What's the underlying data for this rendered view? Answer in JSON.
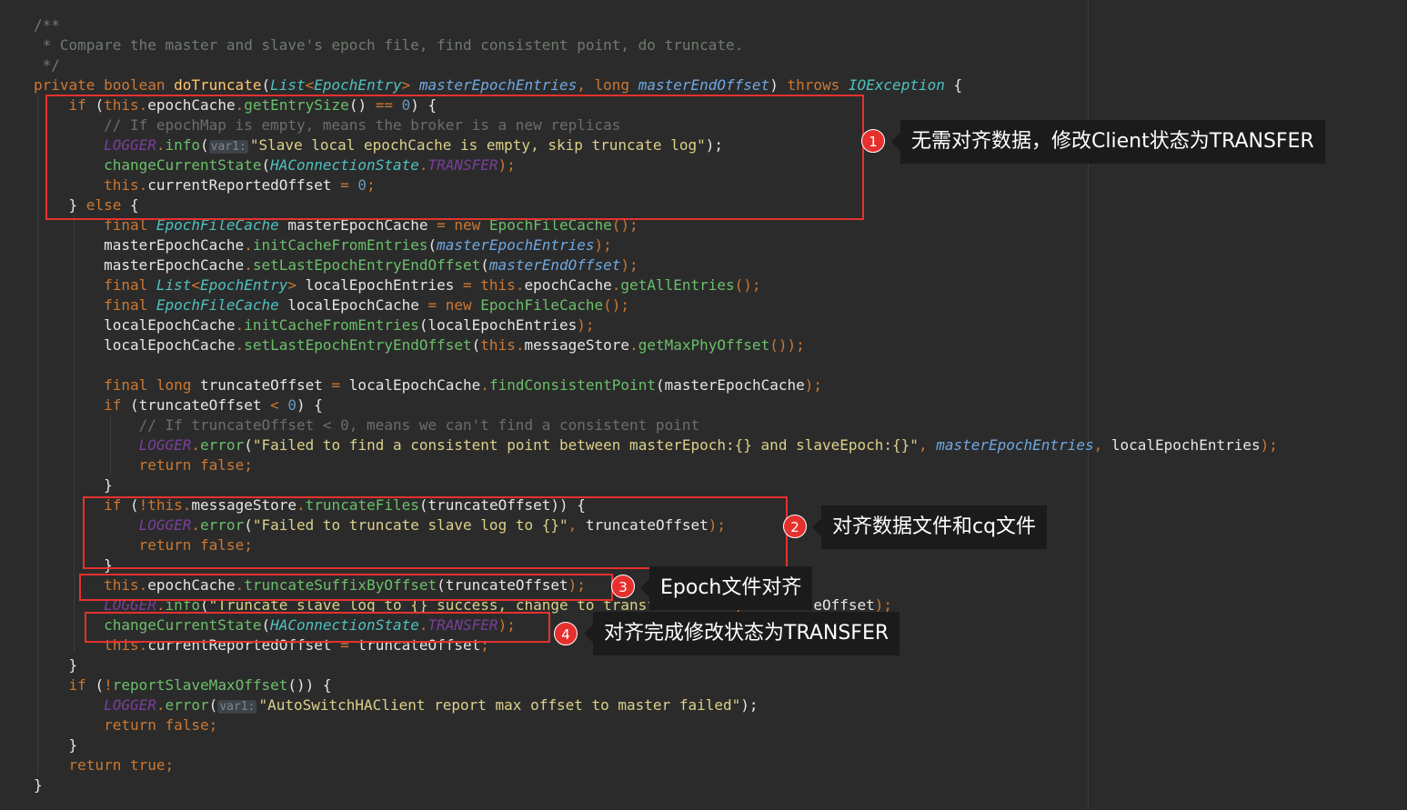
{
  "code_lines": [
    [
      [
        "/**",
        "t-doc"
      ]
    ],
    [
      [
        " * Compare the master and slave's epoch file, find consistent point, do truncate.",
        "t-doc"
      ]
    ],
    [
      [
        " */",
        "t-doc"
      ]
    ],
    [
      [
        "private ",
        "t-kw"
      ],
      [
        "boolean ",
        "t-kw"
      ],
      [
        "doTruncate",
        "t-fn"
      ],
      [
        "(",
        "t-plain"
      ],
      [
        "List",
        "t-cls2"
      ],
      [
        "<",
        "t-kw"
      ],
      [
        "EpochEntry",
        "t-cls2"
      ],
      [
        "> ",
        "t-kw"
      ],
      [
        "masterEpochEntries",
        "t-param"
      ],
      [
        ", ",
        "t-kw"
      ],
      [
        "long ",
        "t-kw"
      ],
      [
        "masterEndOffset",
        "t-param"
      ],
      [
        ") ",
        "t-plain"
      ],
      [
        "throws ",
        "t-kw"
      ],
      [
        "IOException ",
        "t-cls2"
      ],
      [
        "{",
        "t-plain"
      ]
    ],
    [
      [
        "    "
      ],
      [
        "if ",
        "t-kw"
      ],
      [
        "(",
        "t-plain"
      ],
      [
        "this",
        "t-kw"
      ],
      [
        ".",
        "t-kw"
      ],
      [
        "epochCache",
        "t-plain"
      ],
      [
        ".",
        "t-kw"
      ],
      [
        "getEntrySize",
        "t-method"
      ],
      [
        "() ",
        "t-plain"
      ],
      [
        "== ",
        "t-kw"
      ],
      [
        "0",
        "t-num"
      ],
      [
        ") {",
        "t-plain"
      ]
    ],
    [
      [
        "        "
      ],
      [
        "// If epochMap is empty, means the broker is a new replicas",
        "t-cmt"
      ]
    ],
    [
      [
        "        "
      ],
      [
        "LOGGER",
        "t-const"
      ],
      [
        ".",
        "t-kw"
      ],
      [
        "info",
        "t-method"
      ],
      [
        "(",
        "t-plain"
      ],
      [
        "var1:",
        "t-hint-x"
      ],
      [
        "\"Slave local epochCache is empty, skip truncate log\"",
        "t-str"
      ],
      [
        ");",
        "t-plain"
      ]
    ],
    [
      [
        "        "
      ],
      [
        "changeCurrentState",
        "t-method"
      ],
      [
        "(",
        "t-plain"
      ],
      [
        "HAConnectionState",
        "t-cls2"
      ],
      [
        ".",
        "t-kw"
      ],
      [
        "TRANSFER",
        "t-const"
      ],
      [
        ");",
        "t-kw"
      ]
    ],
    [
      [
        "        "
      ],
      [
        "this",
        "t-kw"
      ],
      [
        ".",
        "t-kw"
      ],
      [
        "currentReportedOffset ",
        "t-plain"
      ],
      [
        "= ",
        "t-kw"
      ],
      [
        "0",
        "t-num"
      ],
      [
        ";",
        "t-kw"
      ]
    ],
    [
      [
        "    "
      ],
      [
        "} ",
        "t-plain"
      ],
      [
        "else ",
        "t-kw"
      ],
      [
        "{",
        "t-plain"
      ]
    ],
    [
      [
        "        "
      ],
      [
        "final ",
        "t-kw"
      ],
      [
        "EpochFileCache ",
        "t-cls2"
      ],
      [
        "masterEpochCache ",
        "t-plain"
      ],
      [
        "= ",
        "t-kw"
      ],
      [
        "new ",
        "t-kw"
      ],
      [
        "EpochFileCache",
        "t-method"
      ],
      [
        "();",
        "t-kw"
      ]
    ],
    [
      [
        "        "
      ],
      [
        "masterEpochCache",
        "t-plain"
      ],
      [
        ".",
        "t-kw"
      ],
      [
        "initCacheFromEntries",
        "t-method"
      ],
      [
        "(",
        "t-plain"
      ],
      [
        "masterEpochEntries",
        "t-param"
      ],
      [
        ");",
        "t-kw"
      ]
    ],
    [
      [
        "        "
      ],
      [
        "masterEpochCache",
        "t-plain"
      ],
      [
        ".",
        "t-kw"
      ],
      [
        "setLastEpochEntryEndOffset",
        "t-method"
      ],
      [
        "(",
        "t-plain"
      ],
      [
        "masterEndOffset",
        "t-param"
      ],
      [
        ");",
        "t-kw"
      ]
    ],
    [
      [
        "        "
      ],
      [
        "final ",
        "t-kw"
      ],
      [
        "List",
        "t-cls2"
      ],
      [
        "<",
        "t-kw"
      ],
      [
        "EpochEntry",
        "t-cls2"
      ],
      [
        "> ",
        "t-kw"
      ],
      [
        "localEpochEntries ",
        "t-plain"
      ],
      [
        "= ",
        "t-kw"
      ],
      [
        "this",
        "t-kw"
      ],
      [
        ".",
        "t-kw"
      ],
      [
        "epochCache",
        "t-plain"
      ],
      [
        ".",
        "t-kw"
      ],
      [
        "getAllEntries",
        "t-method"
      ],
      [
        "();",
        "t-kw"
      ]
    ],
    [
      [
        "        "
      ],
      [
        "final ",
        "t-kw"
      ],
      [
        "EpochFileCache ",
        "t-cls2"
      ],
      [
        "localEpochCache ",
        "t-plain"
      ],
      [
        "= ",
        "t-kw"
      ],
      [
        "new ",
        "t-kw"
      ],
      [
        "EpochFileCache",
        "t-method"
      ],
      [
        "();",
        "t-kw"
      ]
    ],
    [
      [
        "        "
      ],
      [
        "localEpochCache",
        "t-plain"
      ],
      [
        ".",
        "t-kw"
      ],
      [
        "initCacheFromEntries",
        "t-method"
      ],
      [
        "(",
        "t-plain"
      ],
      [
        "localEpochEntries",
        "t-plain"
      ],
      [
        ");",
        "t-kw"
      ]
    ],
    [
      [
        "        "
      ],
      [
        "localEpochCache",
        "t-plain"
      ],
      [
        ".",
        "t-kw"
      ],
      [
        "setLastEpochEntryEndOffset",
        "t-method"
      ],
      [
        "(",
        "t-plain"
      ],
      [
        "this",
        "t-kw"
      ],
      [
        ".",
        "t-kw"
      ],
      [
        "messageStore",
        "t-plain"
      ],
      [
        ".",
        "t-kw"
      ],
      [
        "getMaxPhyOffset",
        "t-method"
      ],
      [
        "());",
        "t-kw"
      ]
    ],
    [
      [
        ""
      ]
    ],
    [
      [
        "        "
      ],
      [
        "final ",
        "t-kw"
      ],
      [
        "long ",
        "t-kw"
      ],
      [
        "truncateOffset ",
        "t-plain"
      ],
      [
        "= ",
        "t-kw"
      ],
      [
        "localEpochCache",
        "t-plain"
      ],
      [
        ".",
        "t-kw"
      ],
      [
        "findConsistentPoint",
        "t-method"
      ],
      [
        "(",
        "t-plain"
      ],
      [
        "masterEpochCache",
        "t-plain"
      ],
      [
        ");",
        "t-kw"
      ]
    ],
    [
      [
        "        "
      ],
      [
        "if ",
        "t-kw"
      ],
      [
        "(",
        "t-plain"
      ],
      [
        "truncateOffset ",
        "t-plain"
      ],
      [
        "< ",
        "t-kw"
      ],
      [
        "0",
        "t-num"
      ],
      [
        ") {",
        "t-plain"
      ]
    ],
    [
      [
        "            "
      ],
      [
        "// If truncateOffset < 0, means we can't find a consistent point",
        "t-cmt"
      ]
    ],
    [
      [
        "            "
      ],
      [
        "LOGGER",
        "t-const"
      ],
      [
        ".",
        "t-kw"
      ],
      [
        "error",
        "t-method"
      ],
      [
        "(",
        "t-plain"
      ],
      [
        "\"Failed to find a consistent point between masterEpoch:{} and slaveEpoch:{}\"",
        "t-str"
      ],
      [
        ", ",
        "t-kw"
      ],
      [
        "masterEpochEntries",
        "t-param"
      ],
      [
        ", ",
        "t-kw"
      ],
      [
        "localEpochEntries",
        "t-plain"
      ],
      [
        ");",
        "t-kw"
      ]
    ],
    [
      [
        "            "
      ],
      [
        "return ",
        "t-kw"
      ],
      [
        "false",
        "t-kw"
      ],
      [
        ";",
        "t-kw"
      ]
    ],
    [
      [
        "        "
      ],
      [
        "}",
        "t-plain"
      ]
    ],
    [
      [
        "        "
      ],
      [
        "if ",
        "t-kw"
      ],
      [
        "(",
        "t-plain"
      ],
      [
        "!",
        "t-kw"
      ],
      [
        "this",
        "t-kw"
      ],
      [
        ".",
        "t-kw"
      ],
      [
        "messageStore",
        "t-plain"
      ],
      [
        ".",
        "t-kw"
      ],
      [
        "truncateFiles",
        "t-method"
      ],
      [
        "(",
        "t-plain"
      ],
      [
        "truncateOffset",
        "t-plain"
      ],
      [
        ")) {",
        "t-plain"
      ]
    ],
    [
      [
        "            "
      ],
      [
        "LOGGER",
        "t-const"
      ],
      [
        ".",
        "t-kw"
      ],
      [
        "error",
        "t-method"
      ],
      [
        "(",
        "t-plain"
      ],
      [
        "\"Failed to truncate slave log to {}\"",
        "t-str"
      ],
      [
        ", ",
        "t-kw"
      ],
      [
        "truncateOffset",
        "t-plain"
      ],
      [
        ");",
        "t-kw"
      ]
    ],
    [
      [
        "            "
      ],
      [
        "return ",
        "t-kw"
      ],
      [
        "false",
        "t-kw"
      ],
      [
        ";",
        "t-kw"
      ]
    ],
    [
      [
        "        "
      ],
      [
        "}",
        "t-plain"
      ]
    ],
    [
      [
        "        "
      ],
      [
        "this",
        "t-kw"
      ],
      [
        ".",
        "t-kw"
      ],
      [
        "epochCache",
        "t-plain"
      ],
      [
        ".",
        "t-kw"
      ],
      [
        "truncateSuffixByOffset",
        "t-method"
      ],
      [
        "(",
        "t-plain"
      ],
      [
        "truncateOffset",
        "t-plain"
      ],
      [
        ");",
        "t-kw"
      ]
    ],
    [
      [
        "        "
      ],
      [
        "LOGGER",
        "t-const"
      ],
      [
        ".",
        "t-kw"
      ],
      [
        "info",
        "t-method"
      ],
      [
        "(",
        "t-plain"
      ],
      [
        "\"Truncate slave log to {} success, change to transfer state\"",
        "t-str"
      ],
      [
        ", ",
        "t-kw"
      ],
      [
        "truncateOffset",
        "t-plain"
      ],
      [
        ");",
        "t-kw"
      ]
    ],
    [
      [
        "        "
      ],
      [
        "changeCurrentState",
        "t-method"
      ],
      [
        "(",
        "t-plain"
      ],
      [
        "HAConnectionState",
        "t-cls2"
      ],
      [
        ".",
        "t-kw"
      ],
      [
        "TRANSFER",
        "t-const"
      ],
      [
        ");",
        "t-kw"
      ]
    ],
    [
      [
        "        "
      ],
      [
        "this",
        "t-kw"
      ],
      [
        ".",
        "t-kw"
      ],
      [
        "currentReportedOffset ",
        "t-plain"
      ],
      [
        "= ",
        "t-kw"
      ],
      [
        "truncateOffset",
        "t-plain"
      ],
      [
        ";",
        "t-kw"
      ]
    ],
    [
      [
        "    "
      ],
      [
        "}",
        "t-plain"
      ]
    ],
    [
      [
        "    "
      ],
      [
        "if ",
        "t-kw"
      ],
      [
        "(",
        "t-plain"
      ],
      [
        "!",
        "t-kw"
      ],
      [
        "reportSlaveMaxOffset",
        "t-method"
      ],
      [
        "()) {",
        "t-plain"
      ]
    ],
    [
      [
        "        "
      ],
      [
        "LOGGER",
        "t-const"
      ],
      [
        ".",
        "t-kw"
      ],
      [
        "error",
        "t-method"
      ],
      [
        "(",
        "t-plain"
      ],
      [
        "var1:",
        "t-hint-x"
      ],
      [
        "\"AutoSwitchHAClient report max offset to master failed\"",
        "t-str"
      ],
      [
        ");",
        "t-plain"
      ]
    ],
    [
      [
        "        "
      ],
      [
        "return ",
        "t-kw"
      ],
      [
        "false",
        "t-kw"
      ],
      [
        ";",
        "t-kw"
      ]
    ],
    [
      [
        "    "
      ],
      [
        "}",
        "t-plain"
      ]
    ],
    [
      [
        "    "
      ],
      [
        "return ",
        "t-kw"
      ],
      [
        "true",
        "t-kw"
      ],
      [
        ";",
        "t-kw"
      ]
    ],
    [
      [
        "}",
        "t-plain"
      ]
    ]
  ],
  "annotations": [
    {
      "number": "1",
      "text": "无需对齐数据，修改Client状态为TRANSFER"
    },
    {
      "number": "2",
      "text": "对齐数据文件和cq文件"
    },
    {
      "number": "3",
      "text": "Epoch文件对齐"
    },
    {
      "number": "4",
      "text": "对齐完成修改状态为TRANSFER"
    }
  ]
}
